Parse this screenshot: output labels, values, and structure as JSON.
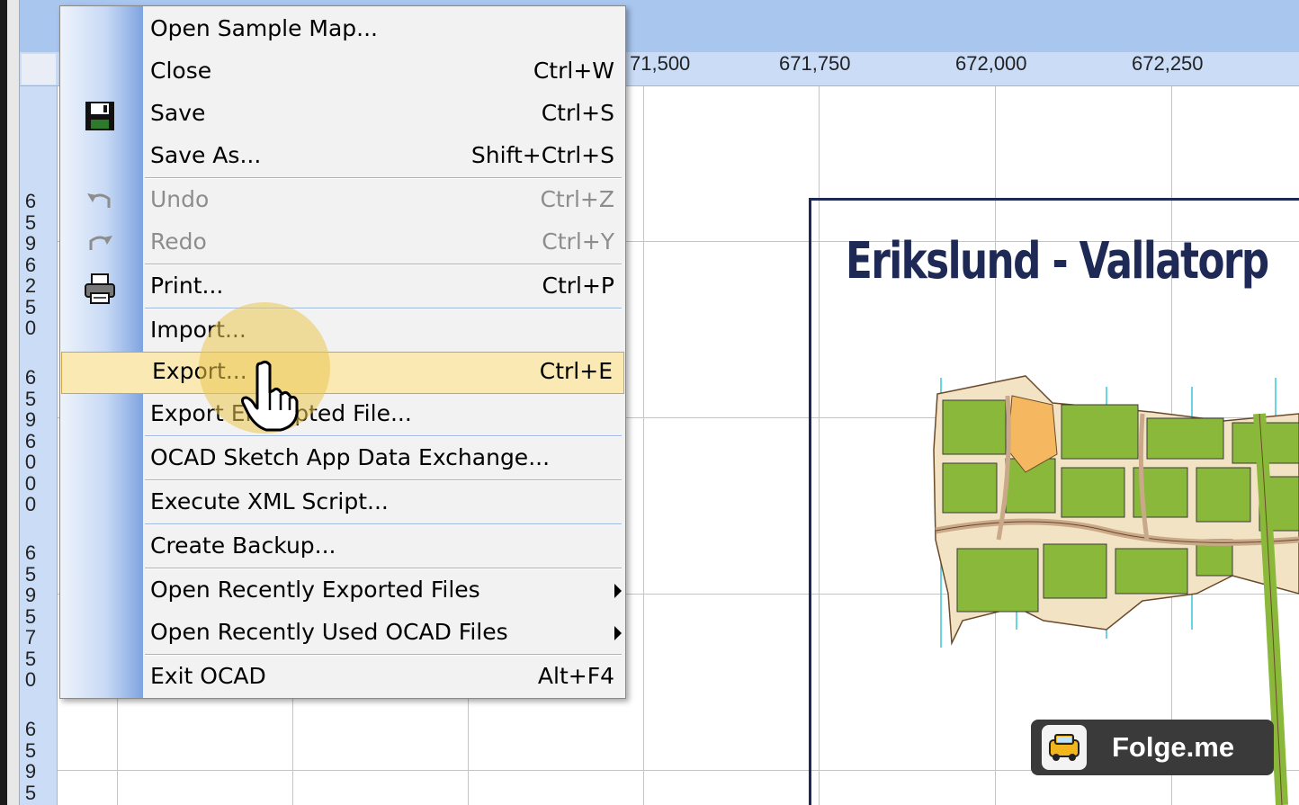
{
  "ruler": {
    "x_labels": [
      "71,500",
      "671,750",
      "672,000",
      "672,250"
    ],
    "y_labels": [
      "6596250",
      "6596000",
      "6595750",
      "6595"
    ]
  },
  "map": {
    "title": "Erikslund - Vallatorp"
  },
  "menu": {
    "items": [
      {
        "label": "Open Sample Map...",
        "shortcut": "",
        "icon": "",
        "enabled": true
      },
      {
        "label": "Close",
        "shortcut": "Ctrl+W",
        "icon": "",
        "enabled": true
      },
      {
        "label": "Save",
        "shortcut": "Ctrl+S",
        "icon": "floppy-disk-icon",
        "enabled": true
      },
      {
        "label": "Save As...",
        "shortcut": "Shift+Ctrl+S",
        "icon": "",
        "enabled": true
      },
      {
        "label": "Undo",
        "shortcut": "Ctrl+Z",
        "icon": "undo-icon",
        "enabled": false
      },
      {
        "label": "Redo",
        "shortcut": "Ctrl+Y",
        "icon": "redo-icon",
        "enabled": false
      },
      {
        "label": "Print...",
        "shortcut": "Ctrl+P",
        "icon": "printer-icon",
        "enabled": true
      },
      {
        "label": "Import...",
        "shortcut": "",
        "icon": "",
        "enabled": true
      },
      {
        "label": "Export...",
        "shortcut": "Ctrl+E",
        "icon": "",
        "enabled": true,
        "highlighted": true
      },
      {
        "label": "Export Encrypted File...",
        "shortcut": "",
        "icon": "",
        "enabled": true
      },
      {
        "label": "OCAD Sketch App Data Exchange...",
        "shortcut": "",
        "icon": "",
        "enabled": true
      },
      {
        "label": "Execute XML Script...",
        "shortcut": "",
        "icon": "",
        "enabled": true
      },
      {
        "label": "Create Backup...",
        "shortcut": "",
        "icon": "",
        "enabled": true
      },
      {
        "label": "Open Recently Exported Files",
        "shortcut": "",
        "icon": "",
        "enabled": true,
        "submenu": true
      },
      {
        "label": "Open Recently Used OCAD Files",
        "shortcut": "",
        "icon": "",
        "enabled": true,
        "submenu": true
      },
      {
        "label": "Exit OCAD",
        "shortcut": "Alt+F4",
        "icon": "",
        "enabled": true
      }
    ]
  },
  "watermark": {
    "text": "Folge.me"
  },
  "colors": {
    "menu_highlight": "#fbe9b4",
    "ruler": "#cadcf6",
    "map_title": "#1e2a55",
    "vegetation_green": "#8ab83a",
    "road_tan": "#c9a98a"
  }
}
